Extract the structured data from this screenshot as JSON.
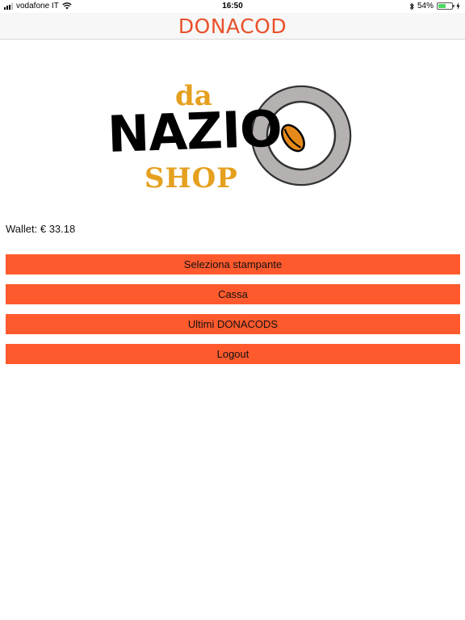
{
  "status_bar": {
    "carrier": "vodafone IT",
    "time": "16:50",
    "battery_percent": "54%",
    "battery_level": 0.54
  },
  "nav": {
    "title": "DONACOD"
  },
  "logo": {
    "line1": "da",
    "line2": "NAZIO",
    "line3": "SHOP"
  },
  "wallet": {
    "text": "Wallet: € 33.18"
  },
  "menu": {
    "items": [
      {
        "label": "Seleziona stampante"
      },
      {
        "label": "Cassa"
      },
      {
        "label": "Ultimi DONACODS"
      },
      {
        "label": "Logout"
      }
    ]
  },
  "colors": {
    "accent": "#ff5a2d",
    "title": "#e8502a",
    "logo_gold": "#e5a01e",
    "ring_gray": "#b5b1b1"
  },
  "icons": [
    "signal-icon",
    "wifi-icon",
    "bluetooth-icon",
    "battery-icon",
    "charging-icon"
  ]
}
